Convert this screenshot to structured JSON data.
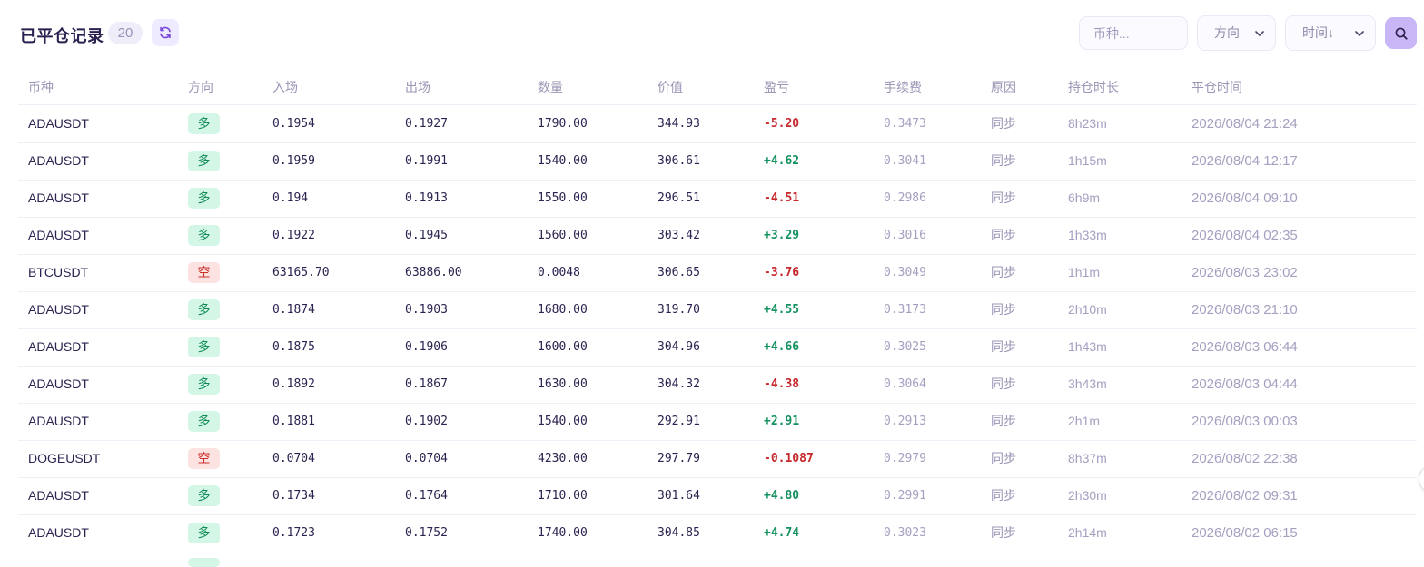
{
  "header": {
    "title": "已平仓记录",
    "count": "20",
    "search_placeholder": "币种...",
    "direction_select": "方向",
    "time_select": "时间↓"
  },
  "columns": [
    "币种",
    "方向",
    "入场",
    "出场",
    "数量",
    "价值",
    "盈亏",
    "手续费",
    "原因",
    "持仓时长",
    "平仓时间"
  ],
  "rows": [
    {
      "symbol": "ADAUSDT",
      "direction": "多",
      "side": "long",
      "entry": "0.1954",
      "exit": "0.1927",
      "qty": "1790.00",
      "value": "344.93",
      "pnl": "-5.20",
      "pnl_sign": "neg",
      "fee": "0.3473",
      "reason": "同步",
      "hold": "8h23m",
      "closed_at": "2026/08/04 21:24"
    },
    {
      "symbol": "ADAUSDT",
      "direction": "多",
      "side": "long",
      "entry": "0.1959",
      "exit": "0.1991",
      "qty": "1540.00",
      "value": "306.61",
      "pnl": "+4.62",
      "pnl_sign": "pos",
      "fee": "0.3041",
      "reason": "同步",
      "hold": "1h15m",
      "closed_at": "2026/08/04 12:17"
    },
    {
      "symbol": "ADAUSDT",
      "direction": "多",
      "side": "long",
      "entry": "0.194",
      "exit": "0.1913",
      "qty": "1550.00",
      "value": "296.51",
      "pnl": "-4.51",
      "pnl_sign": "neg",
      "fee": "0.2986",
      "reason": "同步",
      "hold": "6h9m",
      "closed_at": "2026/08/04 09:10"
    },
    {
      "symbol": "ADAUSDT",
      "direction": "多",
      "side": "long",
      "entry": "0.1922",
      "exit": "0.1945",
      "qty": "1560.00",
      "value": "303.42",
      "pnl": "+3.29",
      "pnl_sign": "pos",
      "fee": "0.3016",
      "reason": "同步",
      "hold": "1h33m",
      "closed_at": "2026/08/04 02:35"
    },
    {
      "symbol": "BTCUSDT",
      "direction": "空",
      "side": "short",
      "entry": "63165.70",
      "exit": "63886.00",
      "qty": "0.0048",
      "value": "306.65",
      "pnl": "-3.76",
      "pnl_sign": "neg",
      "fee": "0.3049",
      "reason": "同步",
      "hold": "1h1m",
      "closed_at": "2026/08/03 23:02"
    },
    {
      "symbol": "ADAUSDT",
      "direction": "多",
      "side": "long",
      "entry": "0.1874",
      "exit": "0.1903",
      "qty": "1680.00",
      "value": "319.70",
      "pnl": "+4.55",
      "pnl_sign": "pos",
      "fee": "0.3173",
      "reason": "同步",
      "hold": "2h10m",
      "closed_at": "2026/08/03 21:10"
    },
    {
      "symbol": "ADAUSDT",
      "direction": "多",
      "side": "long",
      "entry": "0.1875",
      "exit": "0.1906",
      "qty": "1600.00",
      "value": "304.96",
      "pnl": "+4.66",
      "pnl_sign": "pos",
      "fee": "0.3025",
      "reason": "同步",
      "hold": "1h43m",
      "closed_at": "2026/08/03 06:44"
    },
    {
      "symbol": "ADAUSDT",
      "direction": "多",
      "side": "long",
      "entry": "0.1892",
      "exit": "0.1867",
      "qty": "1630.00",
      "value": "304.32",
      "pnl": "-4.38",
      "pnl_sign": "neg",
      "fee": "0.3064",
      "reason": "同步",
      "hold": "3h43m",
      "closed_at": "2026/08/03 04:44"
    },
    {
      "symbol": "ADAUSDT",
      "direction": "多",
      "side": "long",
      "entry": "0.1881",
      "exit": "0.1902",
      "qty": "1540.00",
      "value": "292.91",
      "pnl": "+2.91",
      "pnl_sign": "pos",
      "fee": "0.2913",
      "reason": "同步",
      "hold": "2h1m",
      "closed_at": "2026/08/03 00:03"
    },
    {
      "symbol": "DOGEUSDT",
      "direction": "空",
      "side": "short",
      "entry": "0.0704",
      "exit": "0.0704",
      "qty": "4230.00",
      "value": "297.79",
      "pnl": "-0.1087",
      "pnl_sign": "neg",
      "fee": "0.2979",
      "reason": "同步",
      "hold": "8h37m",
      "closed_at": "2026/08/02 22:38"
    },
    {
      "symbol": "ADAUSDT",
      "direction": "多",
      "side": "long",
      "entry": "0.1734",
      "exit": "0.1764",
      "qty": "1710.00",
      "value": "301.64",
      "pnl": "+4.80",
      "pnl_sign": "pos",
      "fee": "0.2991",
      "reason": "同步",
      "hold": "2h30m",
      "closed_at": "2026/08/02 09:31"
    },
    {
      "symbol": "ADAUSDT",
      "direction": "多",
      "side": "long",
      "entry": "0.1723",
      "exit": "0.1752",
      "qty": "1740.00",
      "value": "304.85",
      "pnl": "+4.74",
      "pnl_sign": "pos",
      "fee": "0.3023",
      "reason": "同步",
      "hold": "2h14m",
      "closed_at": "2026/08/02 06:15"
    }
  ]
}
